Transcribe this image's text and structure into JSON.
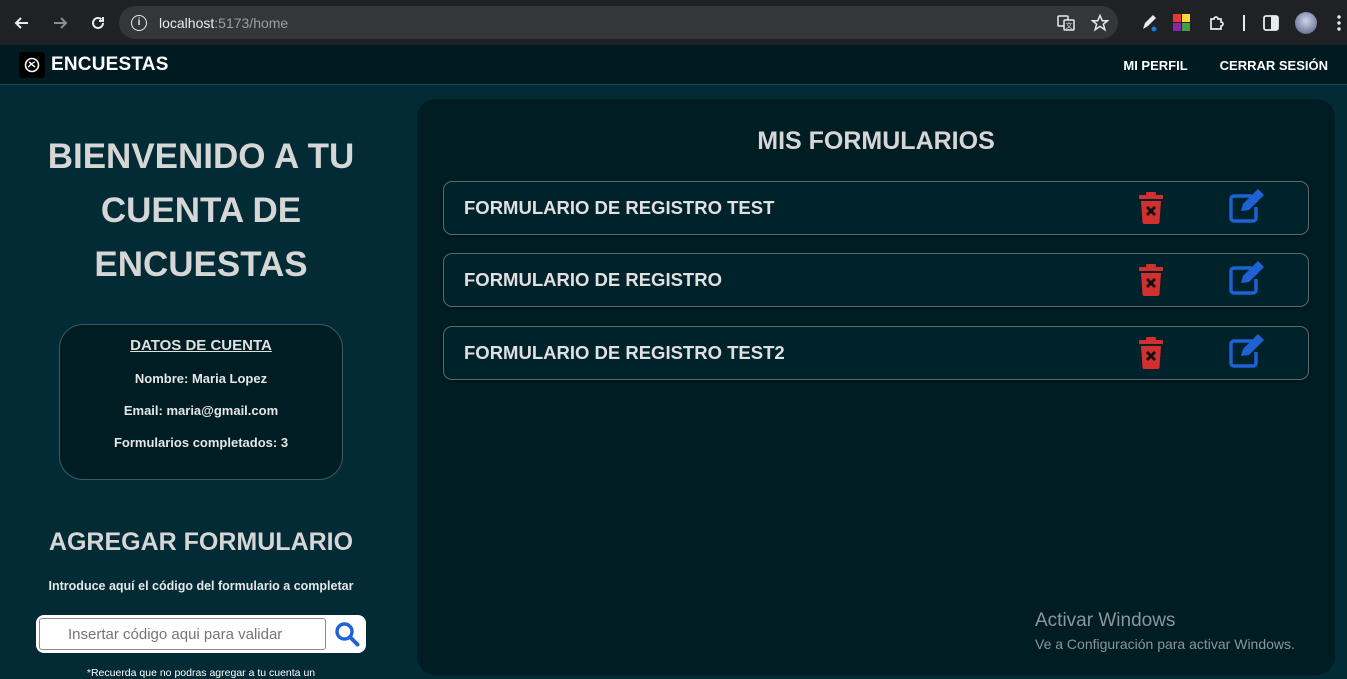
{
  "browser": {
    "url_host": "localhost",
    "url_path": ":5173/home"
  },
  "app": {
    "brand": "ENCUESTAS",
    "nav": {
      "profile": "MI PERFIL",
      "logout": "CERRAR SESIÓN"
    }
  },
  "welcome": {
    "line1": "BIENVENIDO A TU",
    "line2": "CUENTA DE",
    "line3": "ENCUESTAS"
  },
  "account": {
    "title": "DATOS DE CUENTA",
    "name": "Nombre: Maria Lopez",
    "email": "Email: maria@gmail.com",
    "completed": "Formularios completados: 3"
  },
  "add_form": {
    "title": "AGREGAR FORMULARIO",
    "description": "Introduce aquí el código del formulario a completar",
    "placeholder": "Insertar código aqui para validar",
    "note": "*Recuerda que no podras agregar a tu cuenta un"
  },
  "my_forms": {
    "title": "MIS FORMULARIOS",
    "items": [
      {
        "name": "FORMULARIO DE REGISTRO TEST"
      },
      {
        "name": "FORMULARIO DE REGISTRO"
      },
      {
        "name": "FORMULARIO DE REGISTRO TEST2"
      }
    ]
  },
  "watermark": {
    "line1": "Activar Windows",
    "line2": "Ve a Configuración para activar Windows."
  },
  "colors": {
    "background": "#022b35",
    "panel": "#001d24",
    "delete": "#d32f2f",
    "edit": "#1e63d6"
  },
  "icons": [
    "back-icon",
    "forward-icon",
    "reload-icon",
    "info-icon",
    "translate-icon",
    "star-icon",
    "pen-extension-icon",
    "palette-extension-icon",
    "puzzle-extension-icon",
    "sidepanel-icon",
    "profile-avatar-icon",
    "kebab-menu-icon",
    "logo-icon",
    "search-icon",
    "trash-icon",
    "edit-icon"
  ]
}
